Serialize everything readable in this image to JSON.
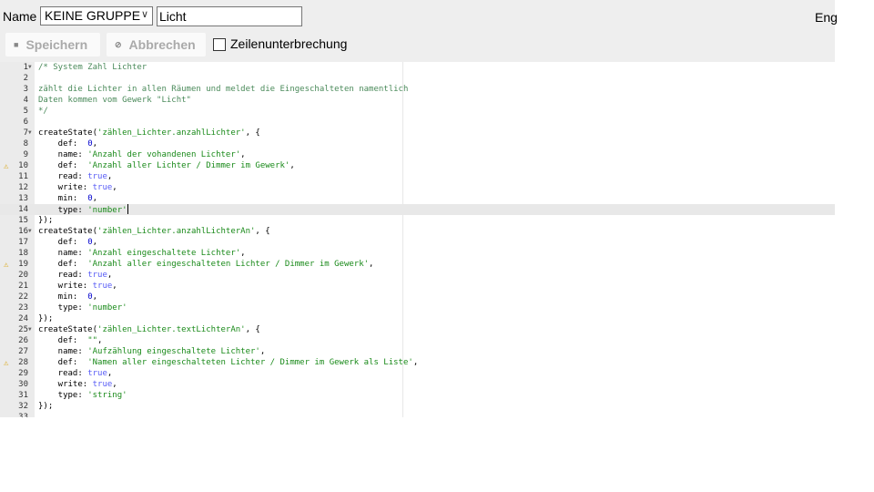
{
  "header": {
    "name_label": "Name",
    "group_select": "KEINE GRUPPE",
    "name_value": "Licht",
    "lang": "Eng"
  },
  "toolbar": {
    "save": "Speichern",
    "save_icon": "save-icon",
    "cancel": "Abbrechen",
    "cancel_icon": "cancel-icon",
    "wrap_label": "Zeilenunterbrechung",
    "wrap_checked": false
  },
  "editor": {
    "active_line": 14,
    "warnings": [
      10,
      19,
      28
    ],
    "folds": [
      1,
      7,
      16,
      25
    ],
    "lines": [
      [
        [
          "comment",
          "/* System Zahl Lichter"
        ]
      ],
      [],
      [
        [
          "comment",
          "zählt die Lichter in allen Räumen und meldet die Eingeschalteten namentlich"
        ]
      ],
      [
        [
          "comment",
          "Daten kommen vom Gewerk \"Licht\""
        ]
      ],
      [
        [
          "comment",
          "*/"
        ]
      ],
      [],
      [
        [
          "plain",
          "createState("
        ],
        [
          "string",
          "'zählen_Lichter.anzahlLichter'"
        ],
        [
          "plain",
          ", {"
        ]
      ],
      [
        [
          "plain",
          "    def:  "
        ],
        [
          "num",
          "0"
        ],
        [
          "plain",
          ","
        ]
      ],
      [
        [
          "plain",
          "    name: "
        ],
        [
          "string",
          "'Anzahl der vohandenen Lichter'"
        ],
        [
          "plain",
          ","
        ]
      ],
      [
        [
          "plain",
          "    def:  "
        ],
        [
          "string",
          "'Anzahl aller Lichter / Dimmer im Gewerk'"
        ],
        [
          "plain",
          ","
        ]
      ],
      [
        [
          "plain",
          "    read: "
        ],
        [
          "bool",
          "true"
        ],
        [
          "plain",
          ","
        ]
      ],
      [
        [
          "plain",
          "    write: "
        ],
        [
          "bool",
          "true"
        ],
        [
          "plain",
          ","
        ]
      ],
      [
        [
          "plain",
          "    min:  "
        ],
        [
          "num",
          "0"
        ],
        [
          "plain",
          ","
        ]
      ],
      [
        [
          "plain",
          "    type: "
        ],
        [
          "string",
          "'number'"
        ]
      ],
      [
        [
          "plain",
          "});"
        ]
      ],
      [
        [
          "plain",
          "createState("
        ],
        [
          "string",
          "'zählen_Lichter.anzahlLichterAn'"
        ],
        [
          "plain",
          ", {"
        ]
      ],
      [
        [
          "plain",
          "    def:  "
        ],
        [
          "num",
          "0"
        ],
        [
          "plain",
          ","
        ]
      ],
      [
        [
          "plain",
          "    name: "
        ],
        [
          "string",
          "'Anzahl eingeschaltete Lichter'"
        ],
        [
          "plain",
          ","
        ]
      ],
      [
        [
          "plain",
          "    def:  "
        ],
        [
          "string",
          "'Anzahl aller eingeschalteten Lichter / Dimmer im Gewerk'"
        ],
        [
          "plain",
          ","
        ]
      ],
      [
        [
          "plain",
          "    read: "
        ],
        [
          "bool",
          "true"
        ],
        [
          "plain",
          ","
        ]
      ],
      [
        [
          "plain",
          "    write: "
        ],
        [
          "bool",
          "true"
        ],
        [
          "plain",
          ","
        ]
      ],
      [
        [
          "plain",
          "    min:  "
        ],
        [
          "num",
          "0"
        ],
        [
          "plain",
          ","
        ]
      ],
      [
        [
          "plain",
          "    type: "
        ],
        [
          "string",
          "'number'"
        ]
      ],
      [
        [
          "plain",
          "});"
        ]
      ],
      [
        [
          "plain",
          "createState("
        ],
        [
          "string",
          "'zählen_Lichter.textLichterAn'"
        ],
        [
          "plain",
          ", {"
        ]
      ],
      [
        [
          "plain",
          "    def:  "
        ],
        [
          "string",
          "\"\""
        ],
        [
          "plain",
          ","
        ]
      ],
      [
        [
          "plain",
          "    name: "
        ],
        [
          "string",
          "'Aufzählung eingeschaltete Lichter'"
        ],
        [
          "plain",
          ","
        ]
      ],
      [
        [
          "plain",
          "    def:  "
        ],
        [
          "string",
          "'Namen aller eingeschalteten Lichter / Dimmer im Gewerk als Liste'"
        ],
        [
          "plain",
          ","
        ]
      ],
      [
        [
          "plain",
          "    read: "
        ],
        [
          "bool",
          "true"
        ],
        [
          "plain",
          ","
        ]
      ],
      [
        [
          "plain",
          "    write: "
        ],
        [
          "bool",
          "true"
        ],
        [
          "plain",
          ","
        ]
      ],
      [
        [
          "plain",
          "    type: "
        ],
        [
          "string",
          "'string'"
        ]
      ],
      [
        [
          "plain",
          "});"
        ]
      ],
      []
    ]
  }
}
